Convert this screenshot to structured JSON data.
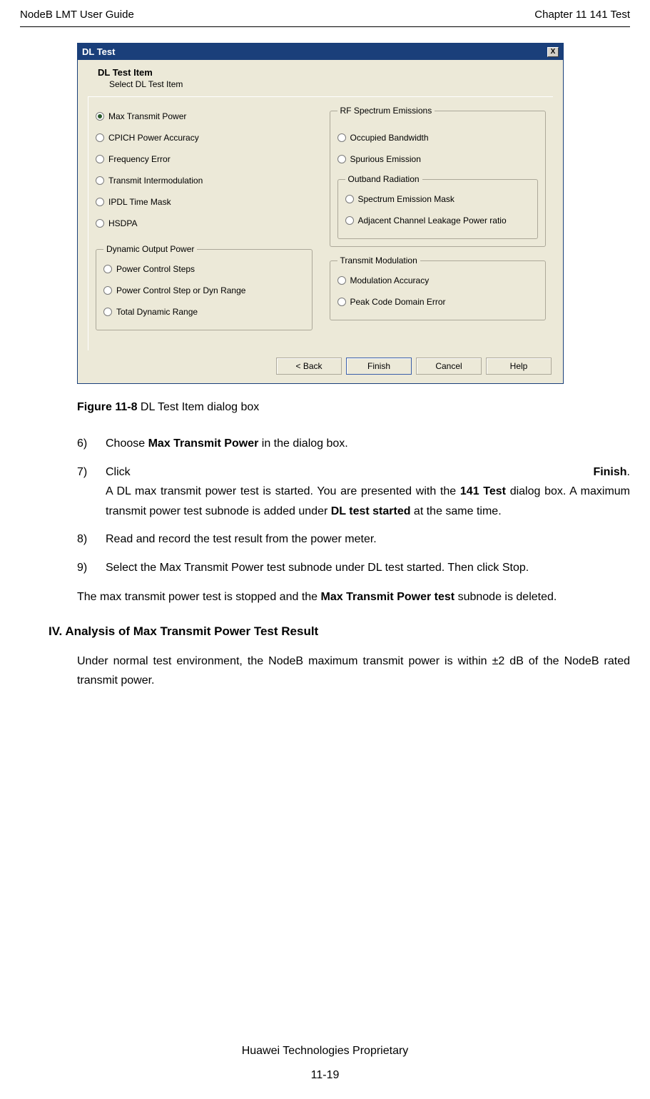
{
  "header": {
    "left": "NodeB LMT User Guide",
    "right": "Chapter 11  141 Test"
  },
  "dialog": {
    "title": "DL Test",
    "close": "X",
    "item_header": "DL Test Item",
    "item_sub": "Select DL Test Item",
    "left_radios": [
      {
        "label": "Max Transmit Power",
        "checked": true
      },
      {
        "label": "CPICH Power Accuracy",
        "checked": false
      },
      {
        "label": "Frequency Error",
        "checked": false
      },
      {
        "label": "Transmit Intermodulation",
        "checked": false
      },
      {
        "label": "IPDL Time Mask",
        "checked": false
      },
      {
        "label": "HSDPA",
        "checked": false
      }
    ],
    "rf_group": {
      "legend": "RF Spectrum Emissions",
      "radios": [
        {
          "label": "Occupied Bandwidth"
        },
        {
          "label": "Spurious Emission"
        }
      ],
      "outband": {
        "legend": "Outband Radiation",
        "radios": [
          {
            "label": "Spectrum Emission Mask"
          },
          {
            "label": "Adjacent Channel Leakage Power ratio"
          }
        ]
      }
    },
    "dyn_group": {
      "legend": "Dynamic Output Power",
      "radios": [
        {
          "label": "Power Control Steps"
        },
        {
          "label": "Power Control Step or Dyn Range"
        },
        {
          "label": "Total Dynamic Range"
        }
      ]
    },
    "mod_group": {
      "legend": "Transmit Modulation",
      "radios": [
        {
          "label": "Modulation Accuracy"
        },
        {
          "label": "Peak Code Domain Error"
        }
      ]
    },
    "buttons": {
      "back": "< Back",
      "finish": "Finish",
      "cancel": "Cancel",
      "help": "Help"
    }
  },
  "caption": {
    "prefix": "Figure 11-8 ",
    "text": "DL Test Item dialog box"
  },
  "steps": {
    "s6": {
      "num": "6)",
      "pre": "Choose ",
      "bold": "Max Transmit Power",
      "post": " in the dialog box."
    },
    "s7": {
      "num": "7)",
      "click": "Click",
      "finish": "Finish",
      "line_a_pre": "A DL max transmit power test is started. You are presented with the ",
      "line_a_bold": "141 Test",
      "line_b_pre": " dialog box. A maximum transmit power test subnode is added under ",
      "line_b_bold": "DL test started",
      "line_b_post": " at the same time."
    },
    "s8": {
      "num": "8)",
      "text": "Read and record the test result from the power meter."
    },
    "s9": {
      "num": "9)",
      "text": "Select the Max Transmit Power test subnode under DL test started. Then click Stop."
    }
  },
  "para1_pre": "The max transmit power test is stopped and the ",
  "para1_bold": "Max Transmit Power test",
  "para1_post": " subnode is deleted.",
  "section_h": "IV. Analysis of Max Transmit Power Test Result",
  "para2": "Under normal test environment, the NodeB maximum transmit power is within ±2 dB of the NodeB rated transmit power.",
  "footer": {
    "line1": "Huawei Technologies Proprietary",
    "line2": "11-19"
  }
}
